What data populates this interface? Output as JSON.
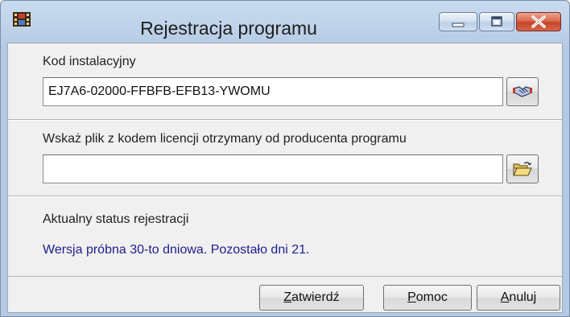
{
  "window": {
    "title": "Rejestracja programu",
    "icon": "film-app-icon",
    "caption_buttons": [
      "minimize-icon",
      "maximize-icon",
      "close-icon"
    ],
    "colors": {
      "titlebar": "#bcd0e8",
      "close_button": "#c6452a",
      "status_text": "#1d1d8f"
    }
  },
  "install_code": {
    "label": "Kod instalacyjny",
    "value": "EJ7A6-02000-FFBFB-EFB13-YWOMU",
    "button_icon": "handshake-icon"
  },
  "license_file": {
    "label": "Wskaż plik z kodem licencji otrzymany od producenta programu",
    "value": "",
    "button_icon": "open-folder-icon"
  },
  "status": {
    "label": "Aktualny status rejestracji",
    "value": "Wersja próbna 30-to dniowa. Pozostało dni 21."
  },
  "buttons": {
    "confirm": {
      "accel": "Z",
      "rest": "atwierdź"
    },
    "help": {
      "accel": "P",
      "rest": "omoc"
    },
    "cancel": {
      "accel": "A",
      "rest": "nuluj"
    }
  }
}
